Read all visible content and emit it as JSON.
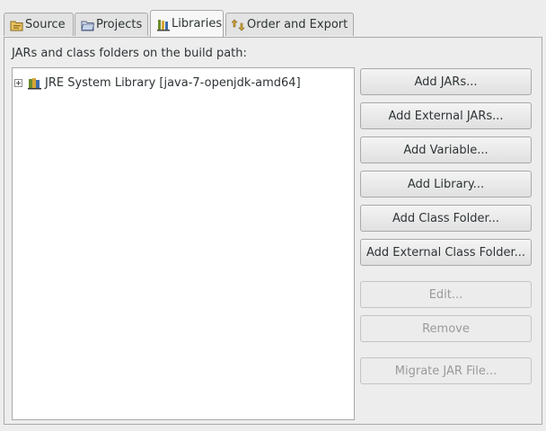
{
  "tabs": [
    {
      "label": "Source",
      "icon": "source-folder-icon",
      "active": false
    },
    {
      "label": "Projects",
      "icon": "projects-folder-icon",
      "active": false
    },
    {
      "label": "Libraries",
      "icon": "libraries-icon",
      "active": true
    },
    {
      "label": "Order and Export",
      "icon": "order-export-icon",
      "active": false
    }
  ],
  "heading": "JARs and class folders on the build path:",
  "tree": {
    "items": [
      {
        "label": "JRE System Library [java-7-openjdk-amd64]",
        "icon": "library-icon",
        "expanded": false
      }
    ]
  },
  "buttons": {
    "add_jars": {
      "label": "Add JARs...",
      "enabled": true
    },
    "add_external_jars": {
      "label": "Add External JARs...",
      "enabled": true
    },
    "add_variable": {
      "label": "Add Variable...",
      "enabled": true
    },
    "add_library": {
      "label": "Add Library...",
      "enabled": true
    },
    "add_class_folder": {
      "label": "Add Class Folder...",
      "enabled": true
    },
    "add_external_class_folder": {
      "label": "Add External Class Folder...",
      "enabled": true
    },
    "edit": {
      "label": "Edit...",
      "enabled": false
    },
    "remove": {
      "label": "Remove",
      "enabled": false
    },
    "migrate_jar": {
      "label": "Migrate JAR File...",
      "enabled": false
    }
  },
  "colors": {
    "background": "#ededed",
    "border": "#a9a9a9",
    "disabled_text": "#9a9a9a"
  }
}
